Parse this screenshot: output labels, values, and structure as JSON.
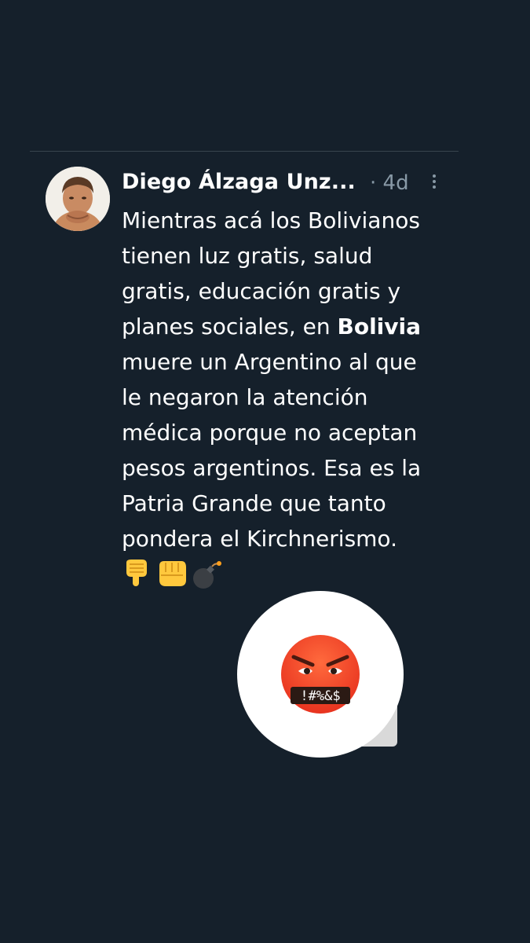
{
  "tweet": {
    "author": "Diego Álzaga Unz...",
    "separator": "·",
    "time": "4d",
    "lines": [
      {
        "text": "Mientras acá los Bolivianos"
      },
      {
        "text": "tienen luz gratis, salud"
      },
      {
        "text": "gratis, educación gratis y"
      },
      {
        "pre": "planes sociales, en ",
        "bold": "Bolivia"
      },
      {
        "text": "muere un Argentino al que"
      },
      {
        "text": "le negaron la atención"
      },
      {
        "text": "médica porque no aceptan"
      },
      {
        "text": "pesos argentinos. Esa es la"
      },
      {
        "text": "Patria Grande que tanto"
      },
      {
        "text": "pondera el Kirchnerismo."
      }
    ],
    "line_bold_pre": "planes sociales, en ",
    "line_bold_word": "Bolivia",
    "emoji_icons": [
      "pointing-down-icon",
      "fist-icon",
      "bomb-icon"
    ]
  },
  "reaction": {
    "icon": "angry-cursing-face-icon",
    "symbols": "!#%&$"
  },
  "colors": {
    "background": "#15202b",
    "divider": "#38444d",
    "text": "#ffffff",
    "meta": "#8899a6"
  }
}
